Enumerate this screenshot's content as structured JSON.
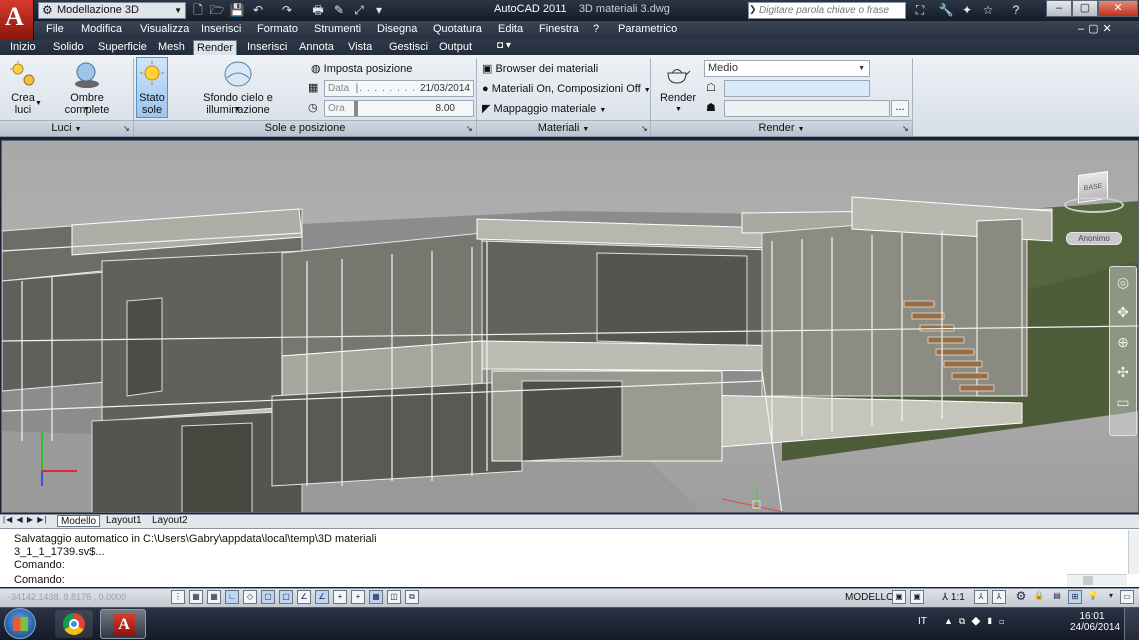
{
  "app": {
    "logo": "A",
    "workspace": "Modellazione 3D",
    "title_app": "AutoCAD 2011",
    "title_file": "3D materiali 3.dwg",
    "search_placeholder": "Digitare parola chiave o frase"
  },
  "menubar": [
    "File",
    "Modifica",
    "Visualizza",
    "Inserisci",
    "Formato",
    "Strumenti",
    "Disegna",
    "Quotatura",
    "Edita",
    "Finestra",
    "?",
    "Parametrico"
  ],
  "ribbon_tabs": [
    "Inizio",
    "Solido",
    "Superficie",
    "Mesh",
    "Render",
    "Inserisci",
    "Annota",
    "Vista",
    "Gestisci",
    "Output"
  ],
  "active_tab": "Render",
  "ribbon": {
    "luci": {
      "crea_luci_1": "Crea",
      "crea_luci_2": "luci",
      "ombre": "Ombre complete",
      "panel": "Luci"
    },
    "sole": {
      "stato_1": "Stato",
      "stato_2": "sole",
      "sfondo": "Sfondo cielo e illuminazione",
      "imposta": "Imposta posizione",
      "data_label": "Data",
      "data_value": "21/03/2014",
      "ora_label": "Ora",
      "ora_value": "8.00",
      "panel": "Sole e posizione"
    },
    "materiali": {
      "browser": "Browser dei materiali",
      "on": "Materiali On, Composizioni Off",
      "mappaggio": "Mappaggio materiale",
      "panel": "Materiali"
    },
    "render": {
      "render_label": "Render",
      "quality": "Medio",
      "panel": "Render"
    }
  },
  "viewcube": {
    "face": "BASE",
    "style": "Anonimo"
  },
  "layout_tabs": [
    "Modello",
    "Layout1",
    "Layout2"
  ],
  "command_lines": [
    "Salvataggio automatico in C:\\Users\\Gabry\\appdata\\local\\temp\\3D materiali",
    "3_1_1_1739.sv$...",
    "Comando:",
    "Comando:"
  ],
  "status": {
    "coords": "-34142.1438, 9.8176 , 0.0000",
    "modello": "MODELLO",
    "scale": "1:1"
  },
  "taskbar": {
    "lang": "IT",
    "time": "16:01",
    "date": "24/06/2014"
  }
}
